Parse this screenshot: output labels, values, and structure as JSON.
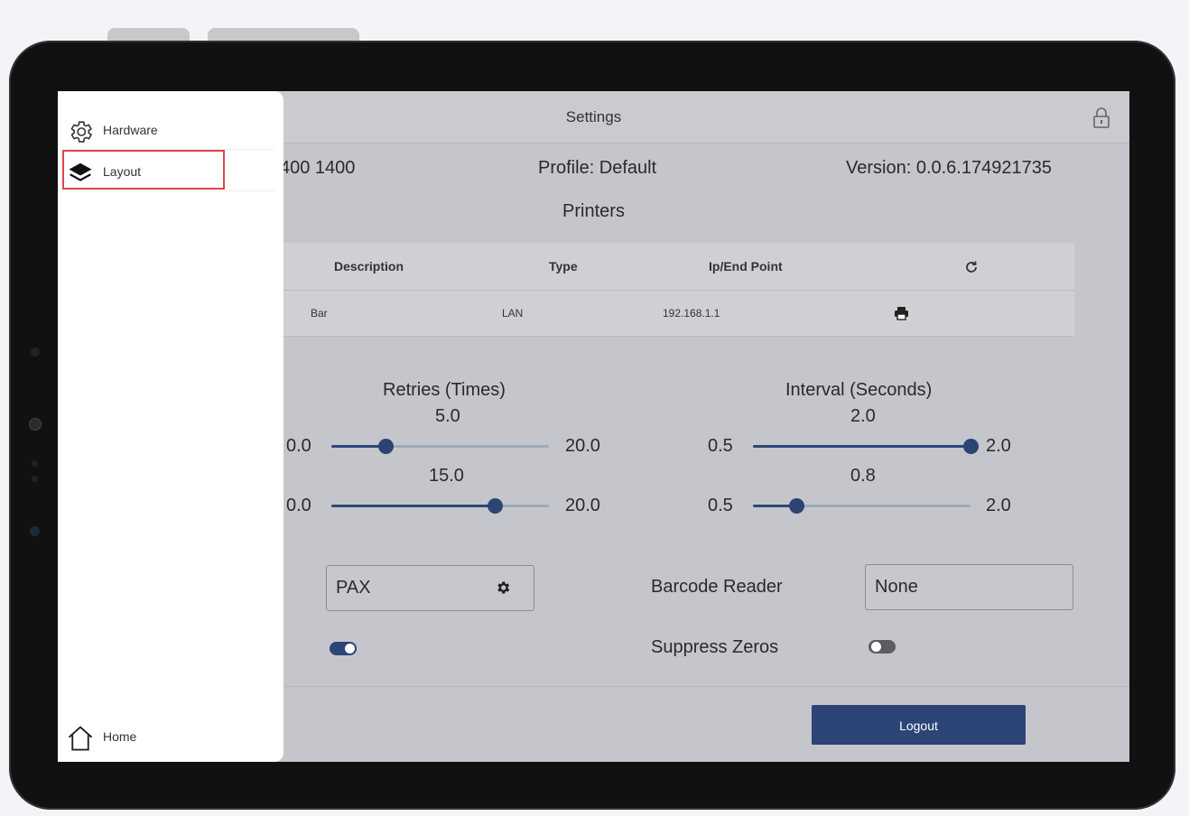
{
  "header": {
    "title": "Settings"
  },
  "info": {
    "device": "400 1400",
    "profile": "Profile: Default",
    "version": "Version: 0.0.6.174921735"
  },
  "printers": {
    "title": "Printers",
    "columns": [
      "Description",
      "Type",
      "Ip/End Point"
    ],
    "rows": [
      {
        "description": "Bar",
        "type": "LAN",
        "endpoint": "192.168.1.1"
      }
    ]
  },
  "retries": {
    "label": "Retries (Times)",
    "slider1": {
      "value_label": "5.0",
      "min": "0.0",
      "max": "20.0",
      "value": 5.0
    },
    "slider2": {
      "value_label": "15.0",
      "min": "0.0",
      "max": "20.0",
      "value": 15.0
    }
  },
  "interval": {
    "label": "Interval (Seconds)",
    "slider1": {
      "value_label": "2.0",
      "min": "0.5",
      "max": "2.0",
      "value": 2.0
    },
    "slider2": {
      "value_label": "0.8",
      "min": "0.5",
      "max": "2.0",
      "value": 0.8
    }
  },
  "payment": {
    "value": "PAX"
  },
  "barcode": {
    "label": "Barcode Reader",
    "value": "None"
  },
  "toggles": {
    "left_on": true,
    "suppress_label": "Suppress Zeros",
    "suppress_on": false
  },
  "logout_label": "Logout",
  "drawer": {
    "items": [
      {
        "label": "Hardware",
        "icon": "gear-icon"
      },
      {
        "label": "Layout",
        "icon": "layers-icon"
      }
    ],
    "home_label": "Home"
  },
  "colors": {
    "accent": "#2c4476",
    "highlight": "#e0454b"
  }
}
